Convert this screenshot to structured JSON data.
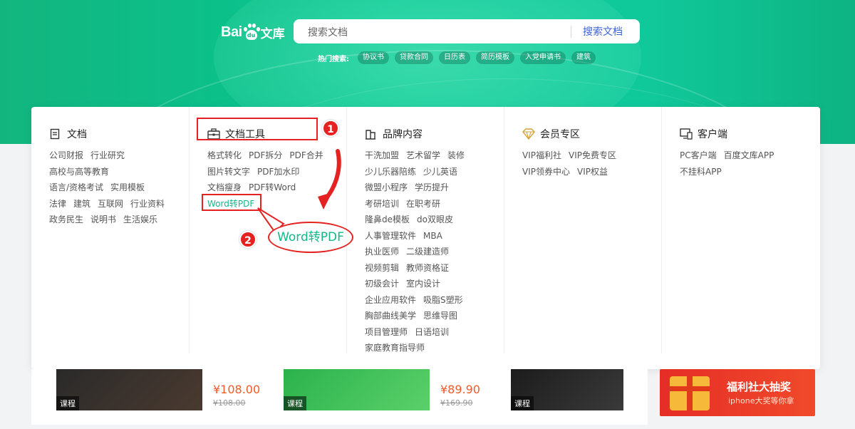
{
  "logo": {
    "bai": "Bai",
    "du": "du",
    "wenku": "文库"
  },
  "search": {
    "placeholder": "搜索文档",
    "button": "搜索文档"
  },
  "hot": {
    "label": "热门搜索:",
    "chips": [
      "协议书",
      "贷款合同",
      "日历表",
      "简历模板",
      "入党申请书",
      "建筑"
    ]
  },
  "menu": {
    "columns": [
      {
        "title": "文档",
        "icon": "document-icon",
        "rows": [
          [
            "公司财报",
            "行业研究"
          ],
          [
            "高校与高等教育"
          ],
          [
            "语言/资格考试",
            "实用模板"
          ],
          [
            "法律",
            "建筑",
            "互联网",
            "行业资料"
          ],
          [
            "政务民生",
            "说明书",
            "生活娱乐"
          ]
        ]
      },
      {
        "title": "文档工具",
        "icon": "toolbox-icon",
        "rows": [
          [
            "格式转化",
            "PDF拆分",
            "PDF合并"
          ],
          [
            "图片转文字",
            "PDF加水印"
          ],
          [
            "文档瘦身",
            "PDF转Word"
          ],
          [
            "Word转PDF"
          ]
        ]
      },
      {
        "title": "品牌内容",
        "icon": "brand-icon",
        "rows": [
          [
            "干洗加盟",
            "艺术留学",
            "装修"
          ],
          [
            "少儿乐器陪练",
            "少儿英语"
          ],
          [
            "微盟小程序",
            "学历提升"
          ],
          [
            "考研培训",
            "在职考研"
          ],
          [
            "隆鼻de模板",
            "do双眼皮"
          ],
          [
            "人事管理软件",
            "MBA"
          ],
          [
            "执业医师",
            "二级建造师"
          ],
          [
            "视频剪辑",
            "教师资格证"
          ],
          [
            "初级会计",
            "室内设计"
          ],
          [
            "企业应用软件",
            "吸脂S塑形"
          ],
          [
            "胸部曲线美学",
            "思维导图"
          ],
          [
            "项目管理师",
            "日语培训"
          ],
          [
            "家庭教育指导师"
          ]
        ]
      },
      {
        "title": "会员专区",
        "icon": "diamond-icon",
        "rows": [
          [
            "VIP福利社",
            "VIP免费专区"
          ],
          [
            "VIP领券中心",
            "VIP权益"
          ]
        ]
      },
      {
        "title": "客户端",
        "icon": "monitor-icon",
        "rows": [
          [
            "PC客户端",
            "百度文库APP"
          ],
          [
            "不挂科APP"
          ]
        ]
      }
    ]
  },
  "annotations": {
    "step1": "1",
    "step2": "2",
    "bubble": "Word转PDF"
  },
  "cards": [
    {
      "tag": "课程",
      "price": "¥108.00",
      "old": "¥108.00"
    },
    {
      "tag": "课程",
      "price": "¥89.90",
      "old": "¥169.90"
    },
    {
      "tag": "课程"
    }
  ],
  "promo": {
    "title": "福利社大抽奖",
    "subtitle": "iphone大奖等你拿"
  },
  "colors": {
    "accent": "#12b88a",
    "annotation": "#e52222",
    "search_button": "#3b63d6",
    "price": "#f05a28"
  }
}
